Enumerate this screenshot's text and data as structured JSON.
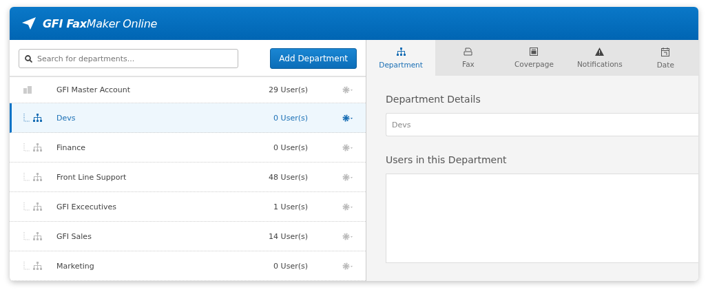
{
  "header": {
    "logo": "**GFI Fax**Maker Online"
  },
  "search": {
    "placeholder": "Search for departments..."
  },
  "add_button": "Add Department",
  "departments": [
    {
      "kind": "account",
      "name": "GFI Master Account",
      "users": "29 User(s)",
      "selected": false
    },
    {
      "kind": "department",
      "name": "Devs",
      "users": "0 User(s)",
      "selected": true
    },
    {
      "kind": "department",
      "name": "Finance",
      "users": "0 User(s)",
      "selected": false
    },
    {
      "kind": "department",
      "name": "Front Line Support",
      "users": "48 User(s)",
      "selected": false
    },
    {
      "kind": "department",
      "name": "GFI Excecutives",
      "users": "1 User(s)",
      "selected": false
    },
    {
      "kind": "department",
      "name": "GFI Sales",
      "users": "14 User(s)",
      "selected": false
    },
    {
      "kind": "department",
      "name": "Marketing",
      "users": "0 User(s)",
      "selected": false
    }
  ],
  "tabs": [
    {
      "kind": "department",
      "label": "Department",
      "selected": true
    },
    {
      "kind": "fax",
      "label": "Fax",
      "selected": false
    },
    {
      "kind": "coverpage",
      "label": "Coverpage",
      "selected": false
    },
    {
      "kind": "notifications",
      "label": "Notifications",
      "selected": false
    },
    {
      "kind": "date",
      "label": "Date",
      "selected": false
    }
  ],
  "details": {
    "title": "Department Details",
    "name_value": "Devs",
    "users_title": "Users in this Department"
  }
}
